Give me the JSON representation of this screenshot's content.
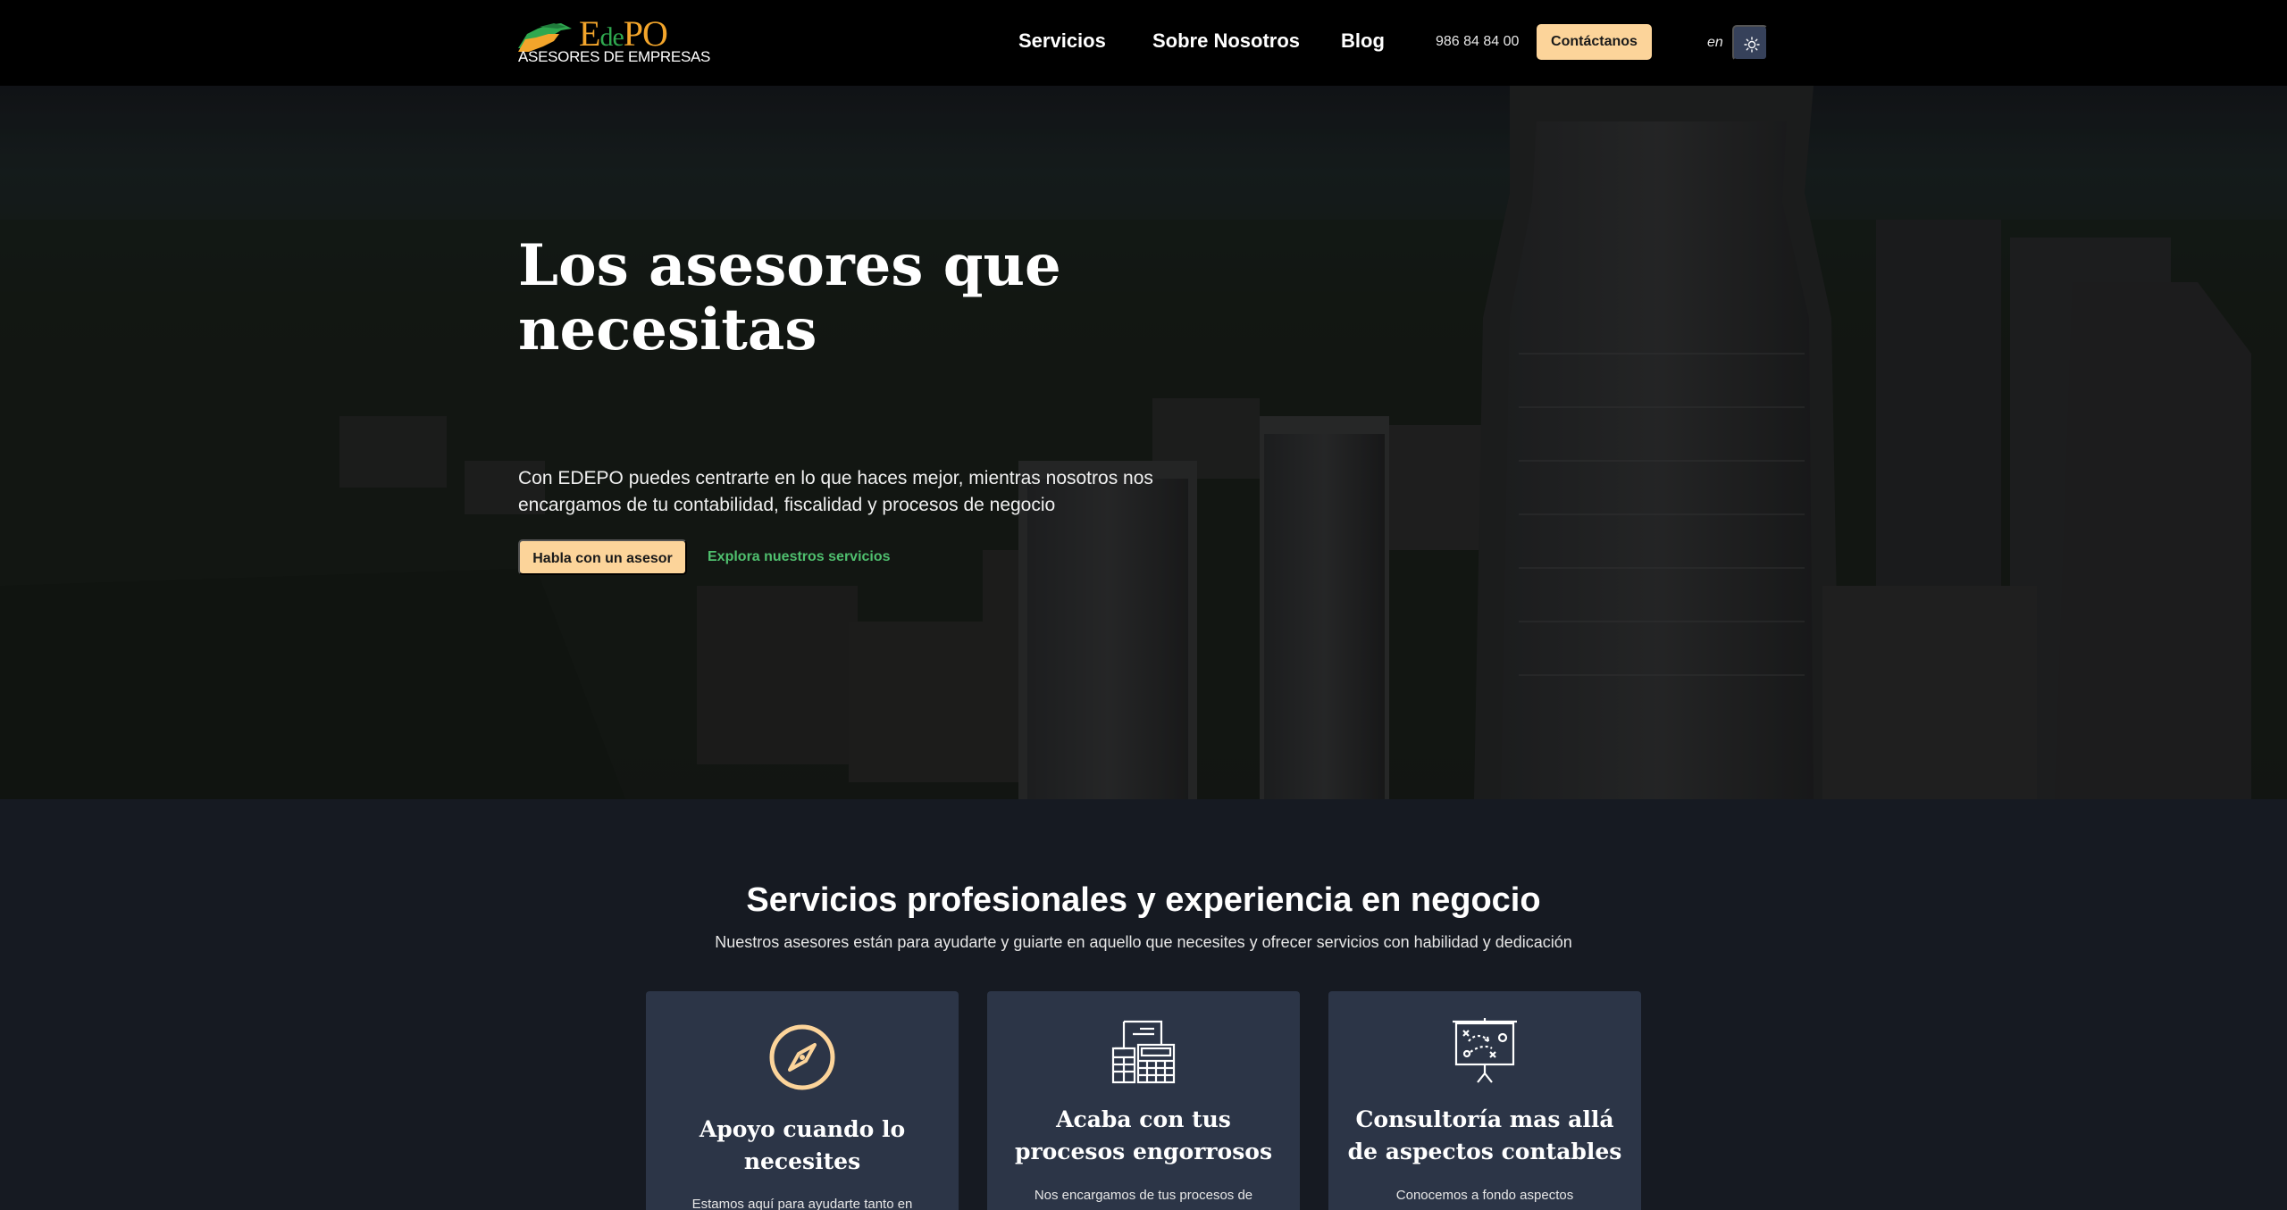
{
  "header": {
    "logo": {
      "wordmark_big": "E",
      "wordmark_small": "de",
      "wordmark_end": "PO",
      "tagline": "ASESORES DE EMPRESAS"
    },
    "nav": [
      {
        "label": "Servicios"
      },
      {
        "label": "Sobre Nosotros"
      },
      {
        "label": "Blog"
      }
    ],
    "phone": "986 84 84 00",
    "contact_label": "Contáctanos",
    "language": "en",
    "theme_icon": "sun-icon"
  },
  "hero": {
    "title": "Los asesores que necesitas",
    "subtitle": "Con EDEPO puedes centrarte en lo que haces mejor, mientras nosotros nos encargamos de tu contabilidad, fiscalidad y procesos de negocio",
    "primary_cta": "Habla con un asesor",
    "secondary_cta": "Explora nuestros servicios"
  },
  "services": {
    "title": "Servicios profesionales y experiencia en negocio",
    "subtitle": "Nuestros asesores están para ayudarte y guiarte en aquello que necesites y ofrecer servicios con habilidad y dedicación",
    "cards": [
      {
        "icon": "compass-icon",
        "title": "Apoyo cuando lo necesites",
        "text": "Estamos aquí para ayudarte tanto en"
      },
      {
        "icon": "documents-calculator-icon",
        "title": "Acaba con tus procesos engorrosos",
        "text": "Nos encargamos de tus procesos de"
      },
      {
        "icon": "strategy-board-icon",
        "title": "Consultoría mas allá de aspectos contables",
        "text": "Conocemos a fondo aspectos"
      }
    ]
  },
  "colors": {
    "accent": "#fcd49a",
    "link_green": "#4fbf6e",
    "card_bg": "#2c3547",
    "page_bg": "#161a22",
    "header_bg": "#000000"
  }
}
